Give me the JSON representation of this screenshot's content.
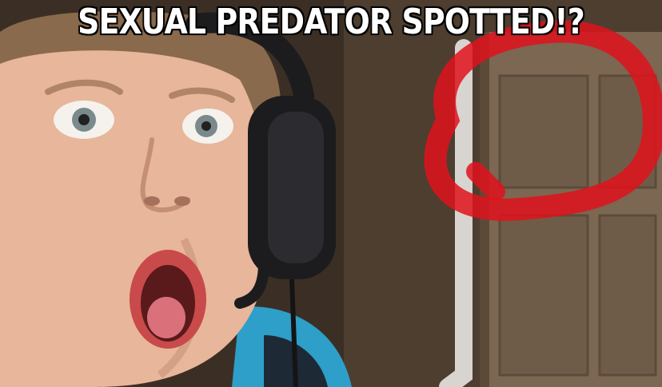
{
  "meme": {
    "caption": "SEXUAL PREDATOR SPOTTED!?"
  },
  "colors": {
    "caption_fill": "#ffffff",
    "caption_outline": "#000000",
    "circle_annotation": "#e0121c",
    "door": "#7a6650",
    "wall": "#4a3a2c",
    "skin": "#e8b69a",
    "headset": "#1c1c1e",
    "chair_accent": "#2e9fc8"
  },
  "scene": {
    "elements": [
      "boy-face",
      "gaming-headset",
      "door",
      "red-circle-annotation",
      "white-cable"
    ]
  }
}
